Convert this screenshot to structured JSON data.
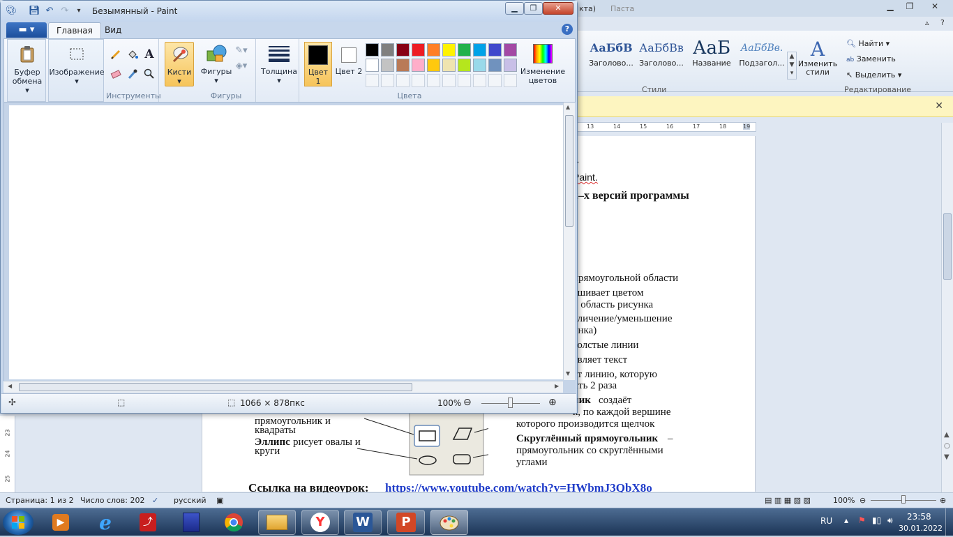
{
  "word": {
    "title_fragment": "Паста",
    "title_fragment2": "кта)",
    "ribbon": {
      "styles": [
        {
          "sample": "АаБбВ",
          "name": "Заголово..."
        },
        {
          "sample": "АаБбВв",
          "name": "Заголово..."
        },
        {
          "sample": "АаБ",
          "name": "Название"
        },
        {
          "sample": "АаБбВв.",
          "name": "Подзагол..."
        }
      ],
      "change_styles": "Изменить стили",
      "styles_group": "Стили",
      "find": "Найти",
      "replace": "Заменить",
      "select": "Выделить",
      "editing_group": "Редактирование"
    },
    "ruler_marks": [
      "13",
      "14",
      "15",
      "16",
      "17",
      "18",
      "19"
    ],
    "vruler_marks": [
      "23",
      "24",
      "25"
    ],
    "doc_lines": [
      "t.",
      "Paint.",
      "2–х версий программы",
      "прямоугольной области",
      "ашивает цветом",
      "о область рисунка",
      "еличение/уменьшение",
      "унка)",
      "толстые линии",
      "авляет текст",
      "ет линию, которую",
      "ить 2 раза",
      "ник",
      "создаёт",
      "к, по каждой вершине",
      "которого производится щелчок",
      "прямоугольник и",
      "квадраты",
      "Эллипс",
      "рисует овалы и",
      "круги",
      "Скруглённый прямоугольник",
      "–",
      "прямоугольник со скруглёнными",
      "углами",
      "Ссылка на видеоурок:",
      "https://www.youtube.com/watch?v=HWbmJ3QbX8o"
    ],
    "status": {
      "page": "Страница: 1 из 2",
      "words": "Число слов: 202",
      "lang": "русский",
      "zoom": "100%"
    }
  },
  "paint": {
    "title": "Безымянный - Paint",
    "tabs": [
      "Главная",
      "Вид"
    ],
    "groups": {
      "clipboard": "Буфер обмена",
      "image": "Изображение",
      "tools": "Инструменты",
      "brushes": "Кисти",
      "shapes_btn": "Фигуры",
      "shapes_group": "Фигуры",
      "thickness": "Толщина",
      "color1": "Цвет 1",
      "color2": "Цвет 2",
      "colors_group": "Цвета",
      "edit_colors": "Изменение цветов"
    },
    "colors": {
      "color1": "#000000",
      "color2": "#ffffff",
      "palette_row1": [
        "#000000",
        "#7f7f7f",
        "#880015",
        "#ed1c24",
        "#ff7f27",
        "#fff200",
        "#22b14c",
        "#00a2e8",
        "#3f48cc",
        "#a349a4"
      ],
      "palette_row2": [
        "#ffffff",
        "#c3c3c3",
        "#b97a57",
        "#ffaec9",
        "#ffc90e",
        "#efe4b0",
        "#b5e61d",
        "#99d9ea",
        "#7092be",
        "#c8bfe7"
      ]
    },
    "status": {
      "size": "1066 × 878пкс",
      "zoom": "100%"
    }
  },
  "taskbar": {
    "lang": "RU",
    "time": "23:58",
    "date": "30.01.2022"
  }
}
